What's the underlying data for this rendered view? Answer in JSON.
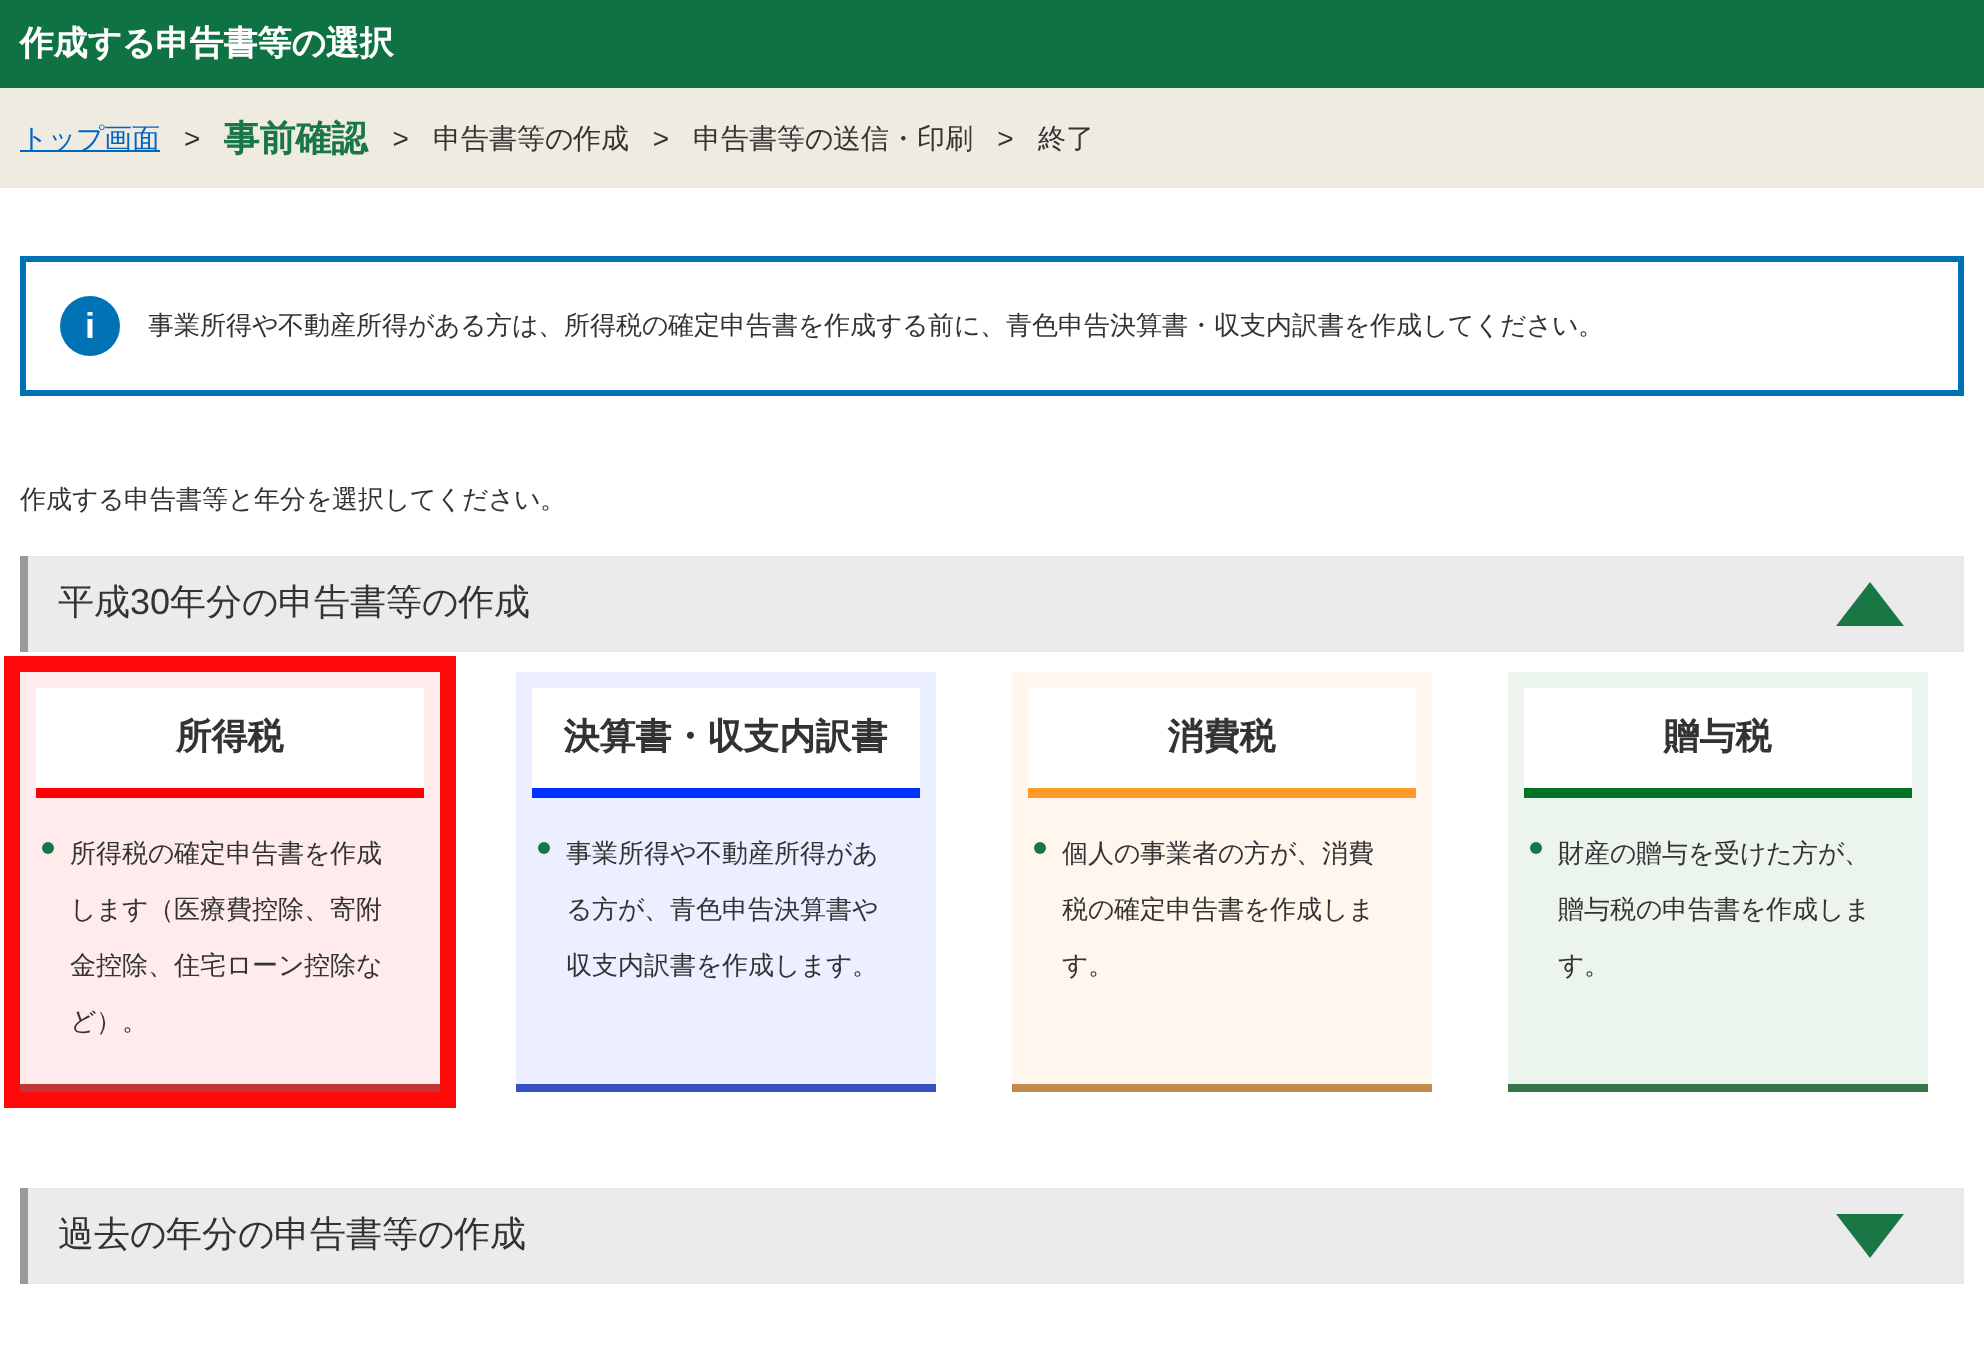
{
  "header": {
    "title": "作成する申告書等の選択"
  },
  "breadcrumb": [
    {
      "label": "トップ画面",
      "kind": "link"
    },
    {
      "separator": ">",
      "label": "事前確認",
      "kind": "current"
    },
    {
      "separator": ">",
      "label": "申告書等の作成",
      "kind": "step"
    },
    {
      "separator": ">",
      "label": "申告書等の送信・印刷",
      "kind": "step"
    },
    {
      "separator": ">",
      "label": "終了",
      "kind": "step"
    }
  ],
  "notice": {
    "icon": "i",
    "text": "事業所得や不動産所得がある方は、所得税の確定申告書を作成する前に、青色申告決算書・収支内訳書を作成してください。"
  },
  "instruction": "作成する申告書等と年分を選択してください。",
  "sections": [
    {
      "title": "平成30年分の申告書等の作成",
      "expanded": true,
      "cards": [
        {
          "title": "所得税",
          "text": "所得税の確定申告書を作成します（医療費控除、寄附金控除、住宅ローン控除など）。",
          "selected": true,
          "color": "#ff0000"
        },
        {
          "title": "決算書・収支内訳書",
          "text": "事業所得や不動産所得がある方が、青色申告決算書や収支内訳書を作成します。",
          "selected": false,
          "color": "#0033ff"
        },
        {
          "title": "消費税",
          "text": "個人の事業者の方が、消費税の確定申告書を作成します。",
          "selected": false,
          "color": "#ff9a2a"
        },
        {
          "title": "贈与税",
          "text": "財産の贈与を受けた方が、贈与税の申告書を作成します。",
          "selected": false,
          "color": "#007423"
        }
      ]
    },
    {
      "title": "過去の年分の申告書等の作成",
      "expanded": false
    }
  ]
}
